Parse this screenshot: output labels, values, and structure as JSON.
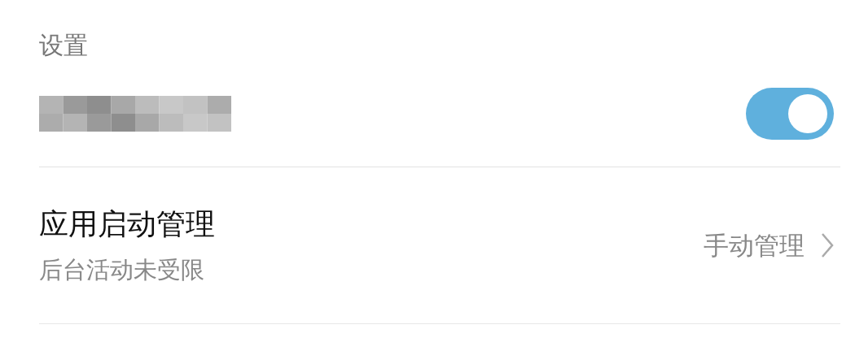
{
  "section_title": "设置",
  "rows": [
    {
      "kind": "toggle",
      "on": true
    },
    {
      "kind": "link",
      "title": "应用启动管理",
      "subtitle": "后台活动未受限",
      "value": "手动管理"
    }
  ]
}
